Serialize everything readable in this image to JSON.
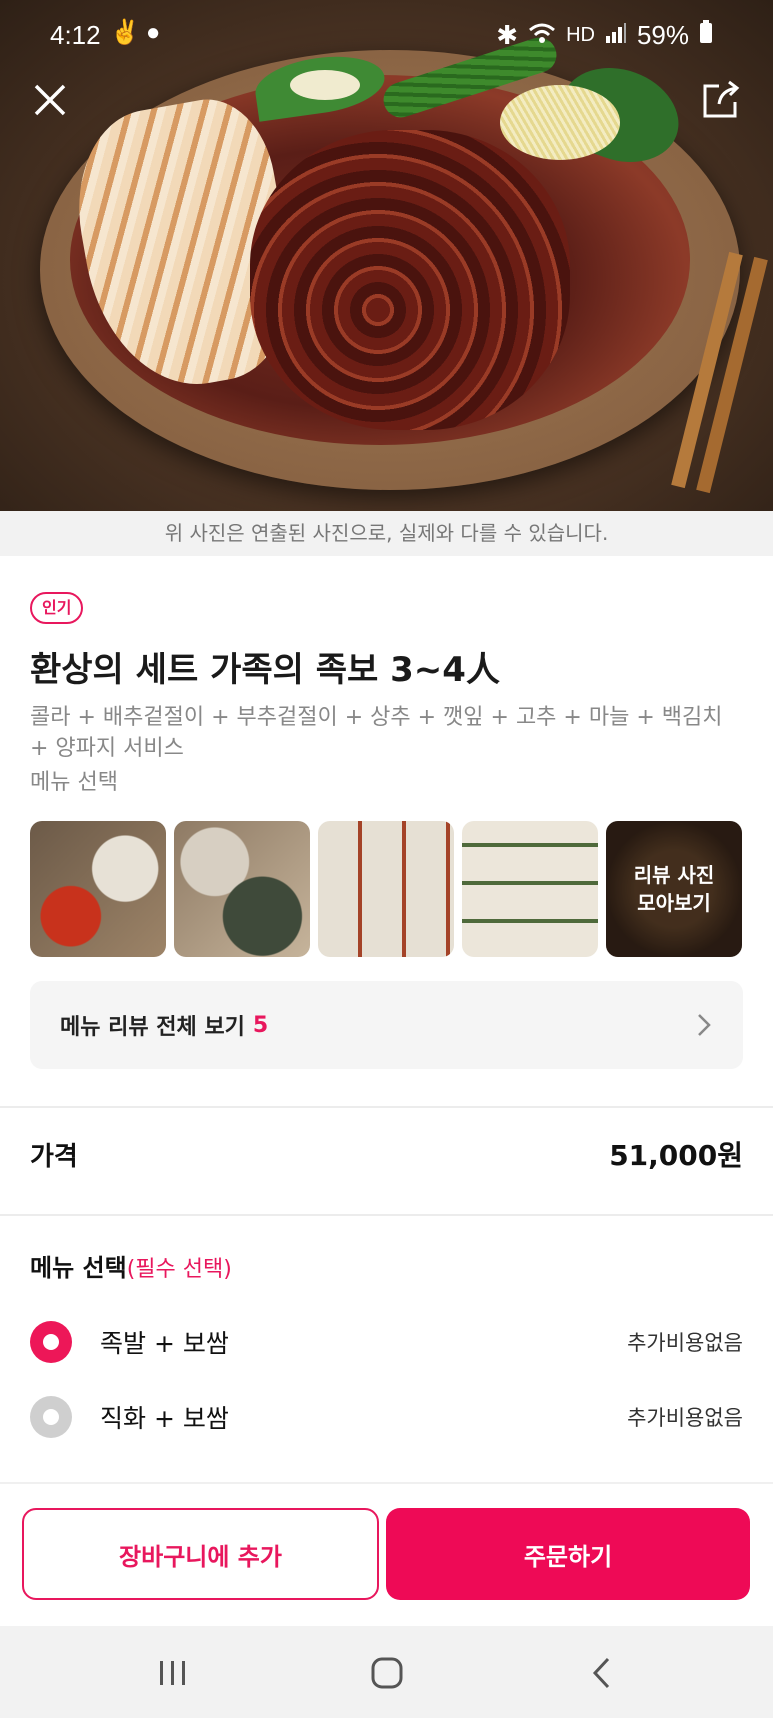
{
  "status_bar": {
    "time": "4:12",
    "network": "HD",
    "battery": "59%"
  },
  "hero": {
    "disclaimer": "위 사진은 연출된 사진으로, 실제와 다를 수 있습니다."
  },
  "product": {
    "badge": "인기",
    "title": "환상의 세트 가족의 족보 3~4人",
    "description": "콜라 + 배추겉절이 + 부추겉절이 + 상추 + 깻잎 + 고추 + 마늘 + 백김치 + 양파지 서비스",
    "description_extra": "메뉴 선택"
  },
  "review_photos": {
    "more_label_line1": "리뷰 사진",
    "more_label_line2": "모아보기"
  },
  "review_link": {
    "label": "메뉴 리뷰 전체 보기",
    "count": "5"
  },
  "price": {
    "label": "가격",
    "value": "51,000원"
  },
  "menu_options": {
    "title": "메뉴 선택",
    "required": "(필수 선택)",
    "items": [
      {
        "label": "족발 + 보쌈",
        "extra": "추가비용없음",
        "selected": true
      },
      {
        "label": "직화 + 보쌈",
        "extra": "추가비용없음",
        "selected": false
      }
    ]
  },
  "actions": {
    "cart": "장바구니에 추가",
    "order": "주문하기"
  },
  "colors": {
    "accent": "#ee0a56",
    "badge": "#e8175d"
  }
}
